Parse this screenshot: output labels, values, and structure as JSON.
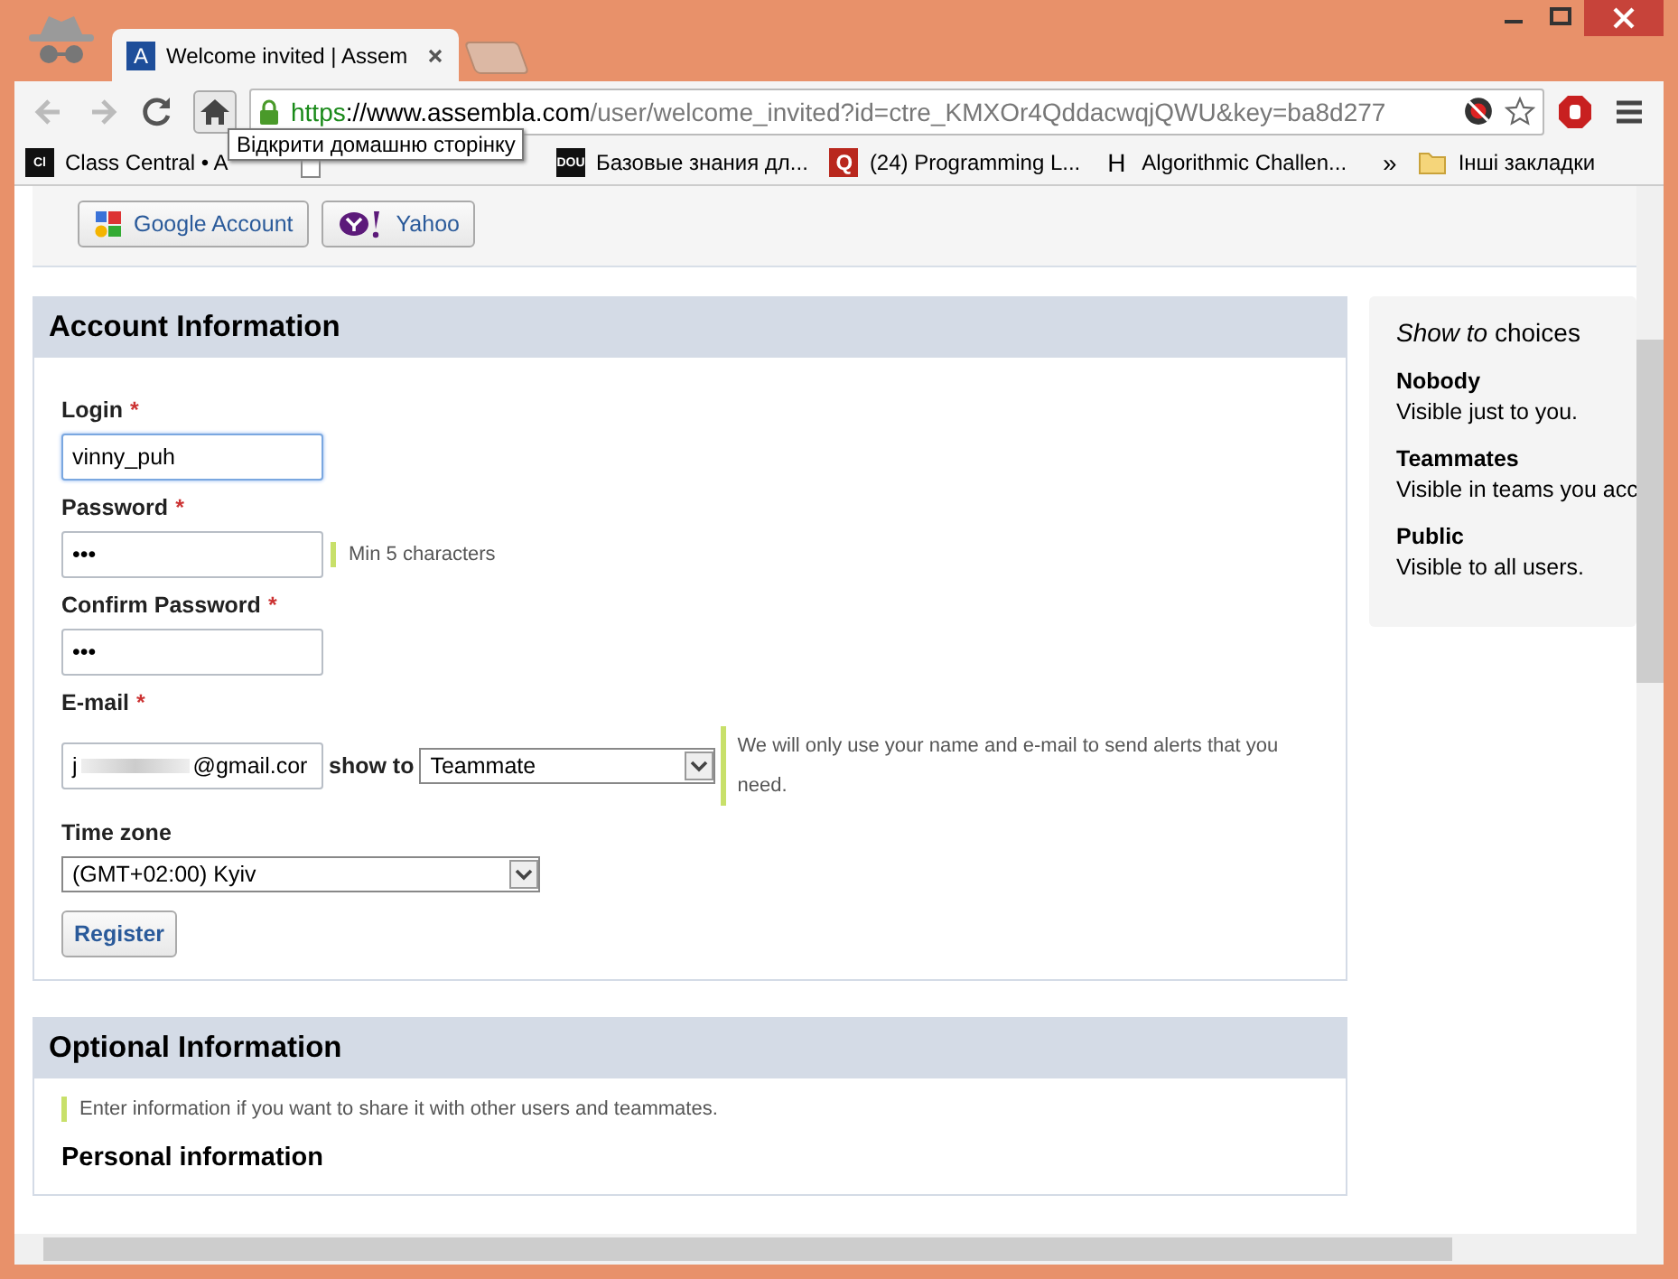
{
  "tabs": [
    {
      "favicon": "A",
      "title": "Welcome invited | Assem",
      "selected": true
    }
  ],
  "address": {
    "scheme": "https",
    "host": "://www.assembla.com",
    "path": "/user/welcome_invited?id=ctre_KMXOr4QddacwqjQWU&key=ba8d277"
  },
  "tooltip": "Відкрити домашню сторінку",
  "bookmarks": [
    {
      "icon": "Cl",
      "label": "Class Central • A",
      "kind": "dark"
    },
    {
      "kind": "page"
    },
    {
      "icon": "DOU",
      "label": "Базовые знания дл...",
      "kind": "dark"
    },
    {
      "icon": "Q",
      "label": "(24) Programming L...",
      "kind": "red"
    },
    {
      "icon": "H",
      "label": "Algorithmic Challen...",
      "kind": "plain"
    }
  ],
  "bookmarks_more": "»",
  "other_bookmarks": "Інші закладки",
  "login_buttons": [
    {
      "label": "Google Account",
      "kind": "google"
    },
    {
      "label": "Yahoo",
      "kind": "yahoo"
    }
  ],
  "account": {
    "title": "Account Information",
    "login": {
      "label": "Login",
      "value": "vinny_puh",
      "focused": true
    },
    "password": {
      "label": "Password",
      "value": "•••",
      "hint": "Min 5 characters"
    },
    "confirm": {
      "label": "Confirm Password",
      "value": "•••"
    },
    "email": {
      "label": "E-mail",
      "value_start": "j",
      "value_end": "@gmail.cor",
      "show_to_label": "show to",
      "show_to": "Teammate",
      "hint": "We will only use your name and e-mail to send alerts that you need."
    },
    "timezone": {
      "label": "Time zone",
      "value": "(GMT+02:00) Kyiv"
    },
    "required_mark": "*",
    "register": "Register"
  },
  "choices": {
    "title": "*Show to* choices",
    "items": [
      {
        "name": "Nobody",
        "text": "Visible just to you."
      },
      {
        "name": "Teammates",
        "text": "Visible in teams you acc"
      },
      {
        "name": "Public",
        "text": "Visible to all users."
      }
    ]
  },
  "optional": {
    "title": "Optional Information",
    "hint": "Enter information if you want to share it with other users and teammates.",
    "subtitle": "Personal information"
  }
}
